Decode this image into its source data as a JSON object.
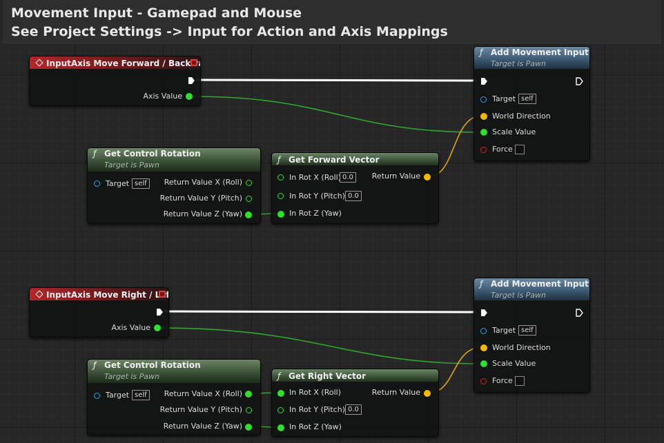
{
  "comment": {
    "line1": "Movement Input - Gamepad and Mouse",
    "line2": "See Project Settings -> Input for Action and Axis Mappings"
  },
  "colors": {
    "exec": "#ffffff",
    "float": "#2ee02e",
    "vector": "#f5b800",
    "object": "#28a8e8",
    "bool": "#d22828",
    "event_header": "#b8252a",
    "pure_header": "#3c5238",
    "call_header": "#3d5a72"
  },
  "icons": {
    "function": "function-f-icon",
    "event": "event-diamond-icon",
    "exec": "exec-arrow-icon",
    "pin": "data-pin-icon"
  },
  "upper": {
    "event": {
      "title": "InputAxis Move Forward / Backward",
      "axis_value": "Axis Value"
    },
    "control_rotation": {
      "title": "Get Control Rotation",
      "subtitle": "Target is Pawn",
      "target": "Target",
      "target_default": "self",
      "out_x": "Return Value X (Roll)",
      "out_y": "Return Value Y (Pitch)",
      "out_z": "Return Value Z (Yaw)"
    },
    "vector_node": {
      "title": "Get Forward Vector",
      "in_x": "In Rot X (Roll)",
      "in_x_default": "0.0",
      "in_y": "In Rot Y (Pitch)",
      "in_y_default": "0.0",
      "in_z": "In Rot Z (Yaw)",
      "out": "Return Value"
    },
    "movement": {
      "title": "Add Movement Input",
      "subtitle": "Target is Pawn",
      "target": "Target",
      "target_default": "self",
      "world_direction": "World Direction",
      "scale_value": "Scale Value",
      "force": "Force"
    }
  },
  "lower": {
    "event": {
      "title": "InputAxis Move Right / Left",
      "axis_value": "Axis Value"
    },
    "control_rotation": {
      "title": "Get Control Rotation",
      "subtitle": "Target is Pawn",
      "target": "Target",
      "target_default": "self",
      "out_x": "Return Value X (Roll)",
      "out_y": "Return Value Y (Pitch)",
      "out_z": "Return Value Z (Yaw)"
    },
    "vector_node": {
      "title": "Get Right Vector",
      "in_x": "In Rot X (Roll)",
      "in_y": "In Rot Y (Pitch)",
      "in_y_default": "0.0",
      "in_z": "In Rot Z (Yaw)",
      "out": "Return Value"
    },
    "movement": {
      "title": "Add Movement Input",
      "subtitle": "Target is Pawn",
      "target": "Target",
      "target_default": "self",
      "world_direction": "World Direction",
      "scale_value": "Scale Value",
      "force": "Force"
    }
  }
}
